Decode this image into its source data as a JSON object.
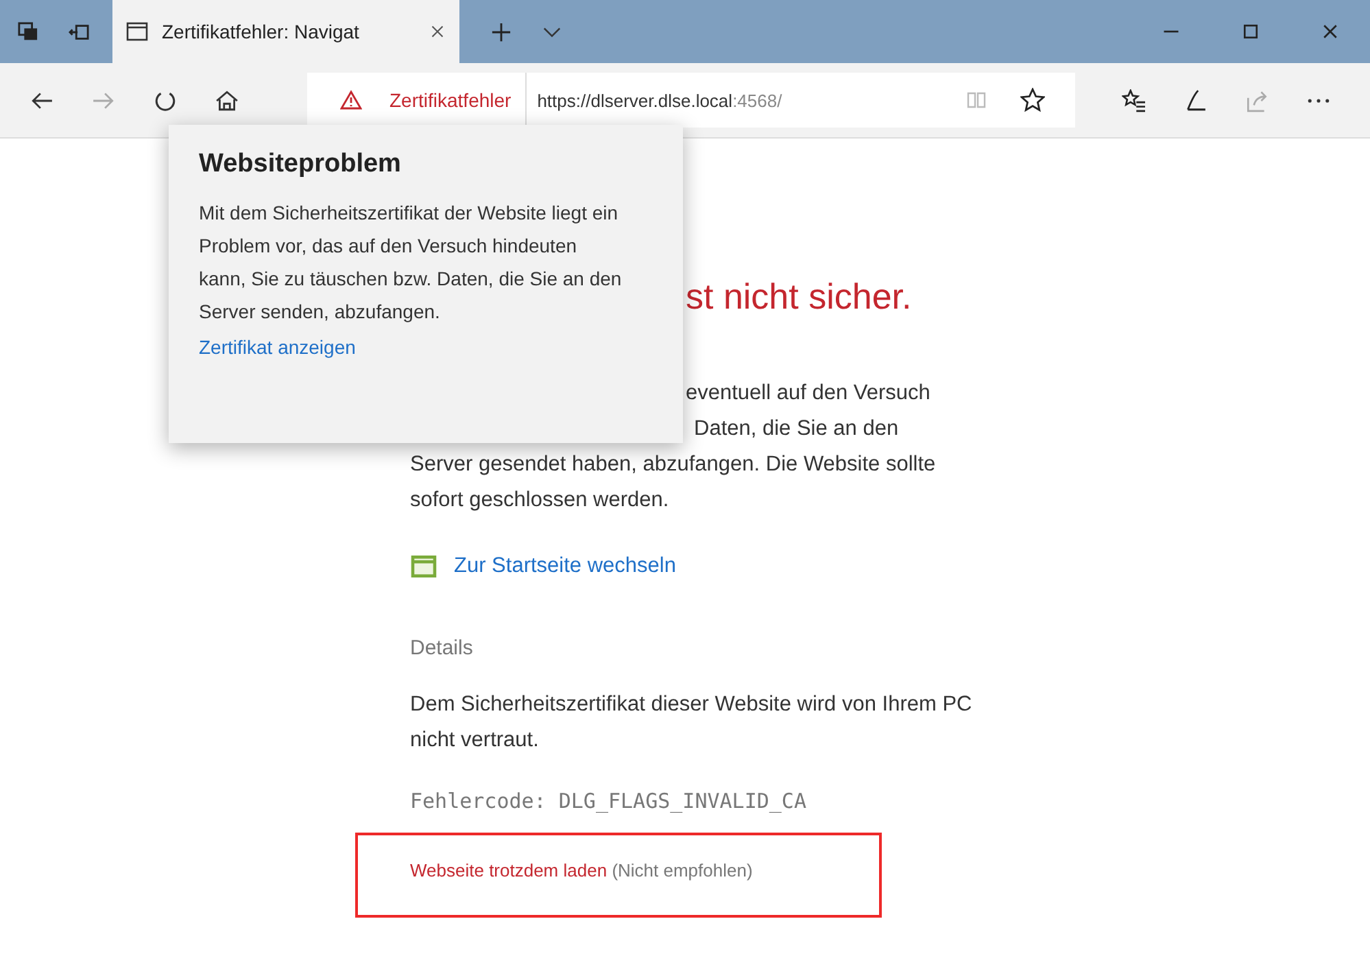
{
  "tab": {
    "title": "Zertifikatfehler: Navigat",
    "selected": true
  },
  "address_bar": {
    "warning": "Zertifikatfehler",
    "url_host": "https://dlserver.dlse.local",
    "url_rest": ":4568/"
  },
  "page": {
    "heading_fragment": "st nicht sicher.",
    "paragraph_lines": [
      "eventuell auf den Versuch",
      "Daten, die Sie an den",
      "Server gesendet haben, abzufangen. Die Website sollte sofort geschlossen werden."
    ],
    "home_link": "Zur Startseite wechseln",
    "details_label": "Details",
    "details_text": "Dem Sicherheitszertifikat dieser Website wird von Ihrem PC nicht vertraut.",
    "error_code": "Fehlercode:  DLG_FLAGS_INVALID_CA",
    "proceed_link": "Webseite trotzdem laden",
    "proceed_note": "(Nicht empfohlen)"
  },
  "popup": {
    "title": "Websiteproblem",
    "text": "Mit dem Sicherheitszertifikat der Website liegt ein Problem vor, das auf den Versuch hindeuten kann, Sie zu täuschen bzw. Daten, die Sie an den Server senden, abzufangen.",
    "link": "Zertifikat anzeigen"
  }
}
